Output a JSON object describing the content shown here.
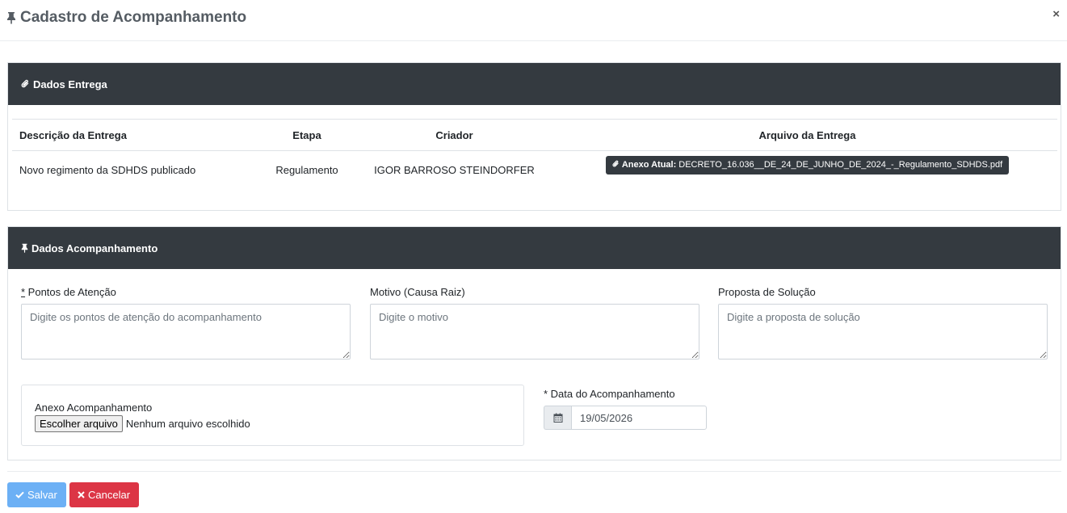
{
  "modal": {
    "title": "Cadastro de Acompanhamento",
    "close_label": "×"
  },
  "dados_entrega": {
    "header": "Dados Entrega",
    "columns": [
      "Descrição da Entrega",
      "Etapa",
      "Criador",
      "Arquivo da Entrega"
    ],
    "row": {
      "descricao": "Novo regimento da SDHDS publicado",
      "etapa": "Regulamento",
      "criador": "IGOR BARROSO STEINDORFER",
      "anexo_label": "Anexo Atual:",
      "anexo_file": "DECRETO_16.036__DE_24_DE_JUNHO_DE_2024_-_Regulamento_SDHDS.pdf"
    }
  },
  "dados_acompanhamento": {
    "header": "Dados Acompanhamento",
    "pontos": {
      "required_mark": "*",
      "label": " Pontos de Atenção",
      "placeholder": "Digite os pontos de atenção do acompanhamento",
      "value": ""
    },
    "motivo": {
      "label": "Motivo (Causa Raiz)",
      "placeholder": "Digite o motivo",
      "value": ""
    },
    "proposta": {
      "label": "Proposta de Solução",
      "placeholder": "Digite a proposta de solução",
      "value": ""
    },
    "anexo": {
      "label": "Anexo Acompanhamento",
      "button_label": "Escolher arquivo",
      "status": "Nenhum arquivo escolhido"
    },
    "data": {
      "label": "* Data do Acompanhamento",
      "value": "19/05/2026"
    }
  },
  "footer": {
    "save_label": "Salvar",
    "cancel_label": "Cancelar"
  },
  "colors": {
    "header_dark": "#343a40",
    "save_button": "#6cb0f5",
    "cancel_button": "#dc3545"
  },
  "icons": {
    "title": "thumbtack-icon",
    "entrega": "paperclip-icon",
    "acompanhamento": "thumbtack-icon",
    "date": "calendar-icon",
    "save": "check-icon",
    "cancel": "times-icon"
  }
}
